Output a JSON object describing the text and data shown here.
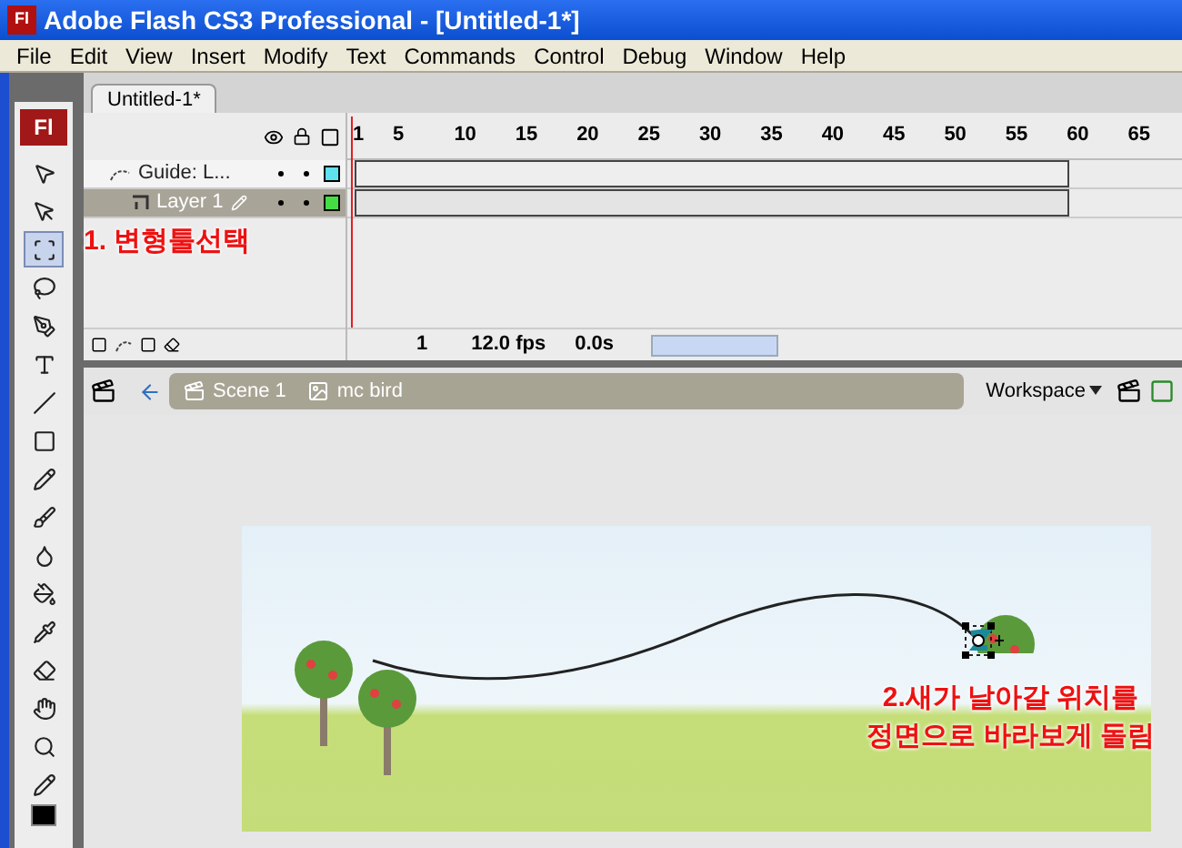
{
  "window": {
    "logo": "Fl",
    "title": "Adobe Flash CS3 Professional - [Untitled-1*]"
  },
  "menu": [
    "File",
    "Edit",
    "View",
    "Insert",
    "Modify",
    "Text",
    "Commands",
    "Control",
    "Debug",
    "Window",
    "Help"
  ],
  "tools_logo": "Fl",
  "tools": [
    {
      "kind": "arrow",
      "selected": false
    },
    {
      "kind": "subselect",
      "selected": false
    },
    {
      "kind": "transform",
      "selected": true
    },
    {
      "kind": "lasso",
      "selected": false
    },
    {
      "kind": "pen",
      "selected": false
    },
    {
      "kind": "text",
      "selected": false
    },
    {
      "kind": "line",
      "selected": false
    },
    {
      "kind": "rect",
      "selected": false
    },
    {
      "kind": "pencil",
      "selected": false
    },
    {
      "kind": "brush",
      "selected": false
    },
    {
      "kind": "ink",
      "selected": false
    },
    {
      "kind": "bucket",
      "selected": false
    },
    {
      "kind": "dropper",
      "selected": false
    },
    {
      "kind": "eraser",
      "selected": false
    },
    {
      "kind": "hand",
      "selected": false
    },
    {
      "kind": "zoom",
      "selected": false
    },
    {
      "kind": "stroke",
      "selected": false
    }
  ],
  "document_tab": {
    "label": "Untitled-1*",
    "selected": true
  },
  "timeline": {
    "frame_numbers": [
      "1",
      "5",
      "10",
      "15",
      "20",
      "25",
      "30",
      "35",
      "40",
      "45",
      "50",
      "55",
      "60",
      "65"
    ],
    "layers": [
      {
        "name": "Guide: L...",
        "kind": "guide",
        "selected": false,
        "color": "#5ee0ee"
      },
      {
        "name": "Layer 1",
        "kind": "normal",
        "selected": true,
        "color": "#44dd44"
      }
    ],
    "current_frame": "1",
    "frame_rate": "12.0 fps",
    "elapsed": "0.0s"
  },
  "edit_bar": {
    "scenes": [
      {
        "label": "Scene 1",
        "kind": "scene"
      },
      {
        "label": "mc bird",
        "kind": "symbol"
      }
    ],
    "workspace": "Workspace"
  },
  "annotations": [
    {
      "text": "1. 변형툴선택"
    },
    {
      "text": "2.새가 날아갈 위치를\n정면으로 바라보게 돌림"
    }
  ]
}
